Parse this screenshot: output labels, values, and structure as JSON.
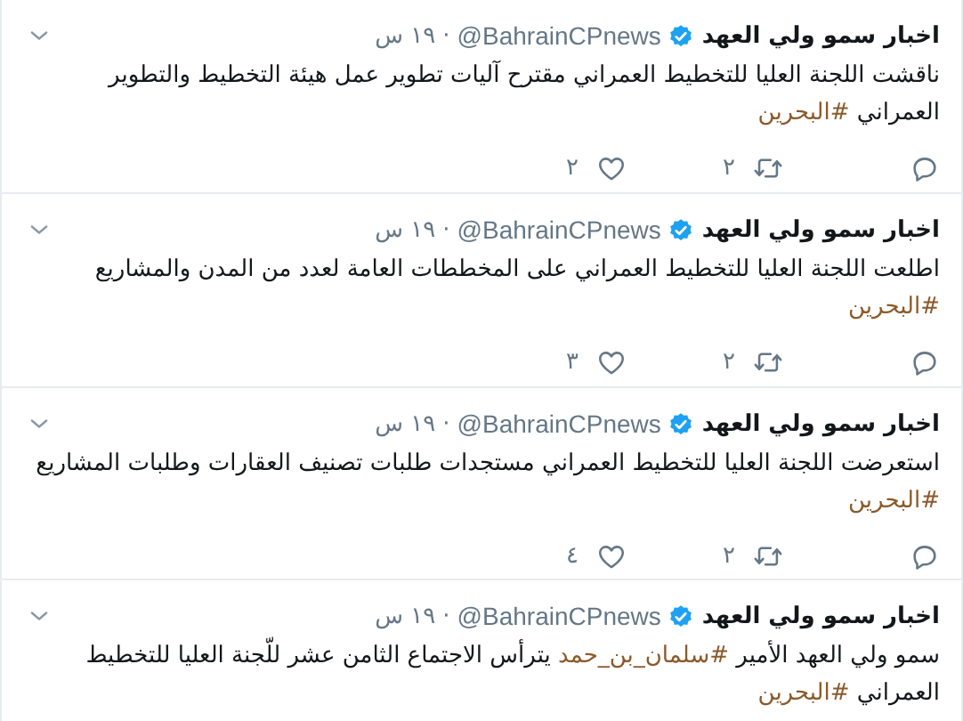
{
  "tweets": [
    {
      "name": "اخبار سمو ولي العهد",
      "verified": true,
      "handle": "@BahrainCPnews",
      "separator": "·",
      "time": "١٩ س",
      "body": [
        {
          "kind": "text",
          "text": "ناقشت اللجنة العليا للتخطيط العمراني مقترح آليات تطوير عمل هيئة التخطيط والتطوير العمراني "
        },
        {
          "kind": "hashtag",
          "text": "#البحرين"
        }
      ],
      "actions": {
        "retweets": "٢",
        "likes": "٢"
      }
    },
    {
      "name": "اخبار سمو ولي العهد",
      "verified": true,
      "handle": "@BahrainCPnews",
      "separator": "·",
      "time": "١٩ س",
      "body": [
        {
          "kind": "text",
          "text": "اطلعت اللجنة العليا للتخطيط العمراني على المخططات العامة لعدد من المدن والمشاريع "
        },
        {
          "kind": "hashtag",
          "text": "#البحرين"
        }
      ],
      "actions": {
        "retweets": "٢",
        "likes": "٣"
      }
    },
    {
      "name": "اخبار سمو ولي العهد",
      "verified": true,
      "handle": "@BahrainCPnews",
      "separator": "·",
      "time": "١٩ س",
      "body": [
        {
          "kind": "text",
          "text": "استعرضت اللجنة العليا للتخطيط العمراني مستجدات طلبات تصنيف العقارات وطلبات المشاريع "
        },
        {
          "kind": "hashtag",
          "text": "#البحرين"
        }
      ],
      "actions": {
        "retweets": "٢",
        "likes": "٤"
      }
    },
    {
      "name": "اخبار سمو ولي العهد",
      "verified": true,
      "handle": "@BahrainCPnews",
      "separator": "·",
      "time": "١٩ س",
      "body": [
        {
          "kind": "text",
          "text": "سمو ولي العهد الأمير "
        },
        {
          "kind": "hashtag",
          "text": "#سلمان_بن_حمد"
        },
        {
          "kind": "text",
          "text": " يترأس الاجتماع الثامن عشر للّجنة العليا للتخطيط العمراني "
        },
        {
          "kind": "hashtag",
          "text": "#البحرين"
        }
      ]
    }
  ]
}
